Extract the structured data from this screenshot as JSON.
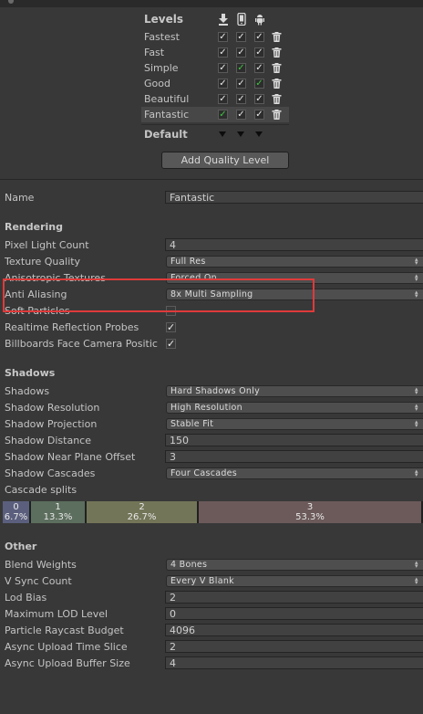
{
  "levels": {
    "title": "Levels",
    "platforms": [
      "download-icon",
      "mobile-icon",
      "android-icon"
    ],
    "rows": [
      {
        "name": "Fastest",
        "checks": [
          true,
          true,
          true
        ],
        "green": [
          false,
          false,
          false
        ]
      },
      {
        "name": "Fast",
        "checks": [
          true,
          true,
          true
        ],
        "green": [
          false,
          false,
          false
        ]
      },
      {
        "name": "Simple",
        "checks": [
          true,
          true,
          true
        ],
        "green": [
          false,
          true,
          false
        ]
      },
      {
        "name": "Good",
        "checks": [
          true,
          true,
          true
        ],
        "green": [
          false,
          false,
          true
        ]
      },
      {
        "name": "Beautiful",
        "checks": [
          true,
          true,
          true
        ],
        "green": [
          false,
          false,
          false
        ]
      },
      {
        "name": "Fantastic",
        "checks": [
          true,
          true,
          true
        ],
        "green": [
          true,
          false,
          false
        ],
        "selected": true
      }
    ],
    "default_label": "Default",
    "add_button": "Add Quality Level"
  },
  "name_row": {
    "label": "Name",
    "value": "Fantastic"
  },
  "rendering": {
    "title": "Rendering",
    "pixel_light_count": {
      "label": "Pixel Light Count",
      "value": "4"
    },
    "texture_quality": {
      "label": "Texture Quality",
      "value": "Full Res"
    },
    "anisotropic": {
      "label": "Anisotropic Textures",
      "value": "Forced On"
    },
    "anti_aliasing": {
      "label": "Anti Aliasing",
      "value": "8x Multi Sampling"
    },
    "soft_particles": {
      "label": "Soft Particles",
      "checked": false
    },
    "realtime_reflection": {
      "label": "Realtime Reflection Probes",
      "checked": true
    },
    "billboards": {
      "label": "Billboards Face Camera Positic",
      "checked": true
    }
  },
  "shadows": {
    "title": "Shadows",
    "shadows": {
      "label": "Shadows",
      "value": "Hard Shadows Only"
    },
    "resolution": {
      "label": "Shadow Resolution",
      "value": "High Resolution"
    },
    "projection": {
      "label": "Shadow Projection",
      "value": "Stable Fit"
    },
    "distance": {
      "label": "Shadow Distance",
      "value": "150"
    },
    "near_plane": {
      "label": "Shadow Near Plane Offset",
      "value": "3"
    },
    "cascades": {
      "label": "Shadow Cascades",
      "value": "Four Cascades"
    },
    "cascade_splits": {
      "label": "Cascade splits",
      "segments": [
        {
          "index": "0",
          "percent": "6.7%",
          "fraction": 0.067,
          "color": "#5b5f7d"
        },
        {
          "index": "1",
          "percent": "13.3%",
          "fraction": 0.133,
          "color": "#5c6e5e"
        },
        {
          "index": "2",
          "percent": "26.7%",
          "fraction": 0.267,
          "color": "#737558"
        },
        {
          "index": "3",
          "percent": "53.3%",
          "fraction": 0.533,
          "color": "#6c5a5a"
        }
      ]
    }
  },
  "other": {
    "title": "Other",
    "blend_weights": {
      "label": "Blend Weights",
      "value": "4 Bones"
    },
    "vsync": {
      "label": "V Sync Count",
      "value": "Every V Blank"
    },
    "lod_bias": {
      "label": "Lod Bias",
      "value": "2"
    },
    "max_lod": {
      "label": "Maximum LOD Level",
      "value": "0"
    },
    "particle_raycast": {
      "label": "Particle Raycast Budget",
      "value": "4096"
    },
    "async_time": {
      "label": "Async Upload Time Slice",
      "value": "2"
    },
    "async_buffer": {
      "label": "Async Upload Buffer Size",
      "value": "4"
    }
  },
  "colors": {
    "highlight": "#e03a3a",
    "check_green": "#3fc53f",
    "background": "#383838"
  }
}
